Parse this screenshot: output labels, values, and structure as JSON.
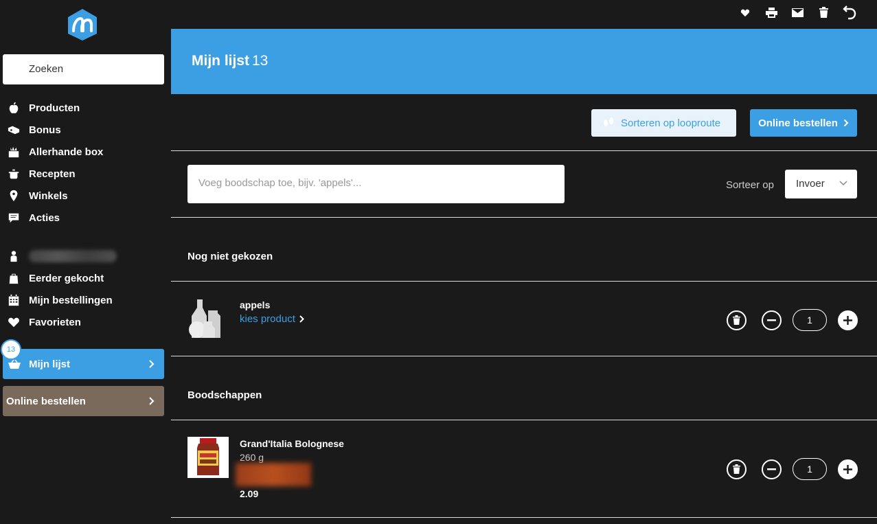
{
  "sidebar": {
    "search_placeholder": "Zoeken",
    "nav": [
      {
        "label": "Producten",
        "icon": "apple-icon"
      },
      {
        "label": "Bonus",
        "icon": "bonus-icon"
      },
      {
        "label": "Allerhande box",
        "icon": "box-icon"
      },
      {
        "label": "Recepten",
        "icon": "pot-icon"
      },
      {
        "label": "Winkels",
        "icon": "location-icon"
      },
      {
        "label": "Acties",
        "icon": "chat-icon"
      }
    ],
    "account_nav": [
      {
        "label": "Eerder gekocht",
        "icon": "bag-icon"
      },
      {
        "label": "Mijn bestellingen",
        "icon": "calendar-icon"
      },
      {
        "label": "Favorieten",
        "icon": "heart-icon"
      }
    ],
    "mijn_lijst": {
      "label": "Mijn lijst",
      "badge": "13"
    },
    "online_bestellen": "Online bestellen"
  },
  "header": {
    "title": "Mijn lijst",
    "count": "13"
  },
  "actions": {
    "sort_route": "Sorteren op looproute",
    "online": "Online bestellen"
  },
  "add": {
    "placeholder": "Voeg boodschap toe, bijv. 'appels'..."
  },
  "sort": {
    "label": "Sorteer op",
    "value": "Invoer"
  },
  "sections": [
    {
      "title": "Nog niet gekozen",
      "items": [
        {
          "name": "appels",
          "link": "kies product",
          "qty": "1"
        }
      ]
    },
    {
      "title": "Boodschappen",
      "items": [
        {
          "name": "Grand'Italia Bolognese",
          "weight": "260 g",
          "price": "2.09",
          "qty": "1"
        }
      ]
    }
  ],
  "colors": {
    "accent": "#3d9fe3",
    "background": "#1a1a1a",
    "online_side": "#7a6a5c"
  }
}
